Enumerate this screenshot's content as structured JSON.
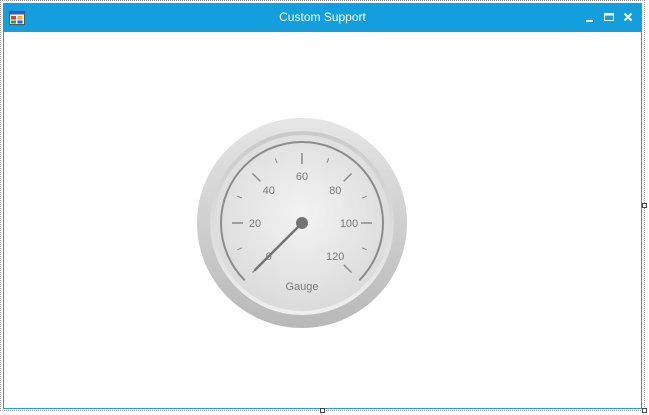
{
  "window": {
    "title": "Custom Support",
    "app_icon": "windows-form-icon",
    "controls": {
      "minimize_icon": "minimize-icon",
      "maximize_icon": "maximize-icon",
      "close_icon": "close-icon"
    },
    "titlebar_color": "#139fdd"
  },
  "gauge": {
    "label": "Gauge",
    "min": 0,
    "max": 120,
    "value": 0,
    "major_ticks": [
      "0",
      "20",
      "40",
      "60",
      "80",
      "100",
      "120"
    ],
    "needle_color": "#737373",
    "label_color": "#7a7a7a"
  }
}
